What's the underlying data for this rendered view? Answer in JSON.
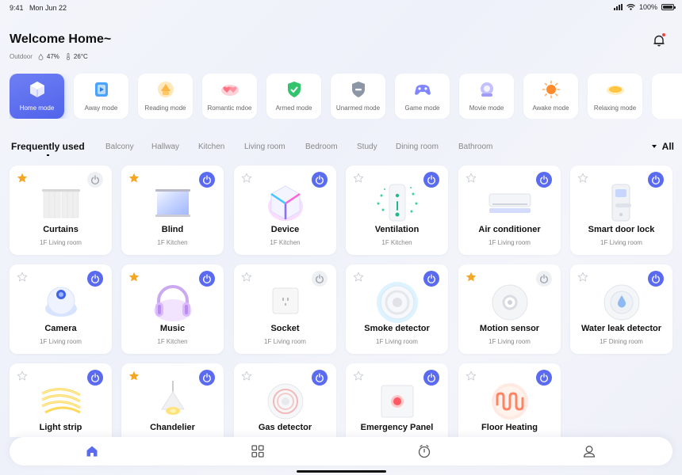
{
  "status": {
    "time": "9:41",
    "date": "Mon Jun 22",
    "battery": "100%"
  },
  "header": {
    "title": "Welcome Home~",
    "outdoor_label": "Outdoor",
    "humidity": "47%",
    "temperature": "26°C"
  },
  "modes": [
    {
      "label": "Home mode",
      "icon": "home-cube-icon",
      "active": true
    },
    {
      "label": "Away mode",
      "icon": "away-icon",
      "active": false
    },
    {
      "label": "Reading mode",
      "icon": "reading-lamp-icon",
      "active": false
    },
    {
      "label": "Romantic mdoe",
      "icon": "romantic-hearts-icon",
      "active": false
    },
    {
      "label": "Armed mode",
      "icon": "shield-check-icon",
      "active": false
    },
    {
      "label": "Unarmed mode",
      "icon": "shield-off-icon",
      "active": false
    },
    {
      "label": "Game mode",
      "icon": "gamepad-icon",
      "active": false
    },
    {
      "label": "Movie mode",
      "icon": "movie-icon",
      "active": false
    },
    {
      "label": "Awake mode",
      "icon": "sun-icon",
      "active": false
    },
    {
      "label": "Relaxing mode",
      "icon": "relax-light-icon",
      "active": false
    }
  ],
  "filters": {
    "title": "Frequently used",
    "tabs": [
      "Balcony",
      "Hallway",
      "Kitchen",
      "Living room",
      "Bedroom",
      "Study",
      "Dining room",
      "Bathroom"
    ],
    "all_label": "All"
  },
  "devices": [
    {
      "name": "Curtains",
      "location": "1F Living room",
      "starred": true,
      "power": "off",
      "icon": "curtains-icon"
    },
    {
      "name": "Blind",
      "location": "1F Kitchen",
      "starred": true,
      "power": "on",
      "icon": "blind-icon"
    },
    {
      "name": "Device",
      "location": "1F Kitchen",
      "starred": false,
      "power": "on",
      "icon": "device-cube-icon"
    },
    {
      "name": "Ventilation",
      "location": "1F Kitchen",
      "starred": false,
      "power": "on",
      "icon": "ventilation-icon"
    },
    {
      "name": "Air conditioner",
      "location": "1F Living room",
      "starred": false,
      "power": "on",
      "icon": "air-conditioner-icon"
    },
    {
      "name": "Smart door lock",
      "location": "1F Living room",
      "starred": false,
      "power": "on",
      "icon": "door-lock-icon"
    },
    {
      "name": "Camera",
      "location": "1F Living room",
      "starred": false,
      "power": "on",
      "icon": "camera-icon"
    },
    {
      "name": "Music",
      "location": "1F Kitchen",
      "starred": true,
      "power": "on",
      "icon": "headphones-icon"
    },
    {
      "name": "Socket",
      "location": "1F Living room",
      "starred": false,
      "power": "off",
      "icon": "socket-icon"
    },
    {
      "name": "Smoke detector",
      "location": "1F Living room",
      "starred": false,
      "power": "on",
      "icon": "smoke-detector-icon"
    },
    {
      "name": "Motion sensor",
      "location": "1F Living room",
      "starred": true,
      "power": "off",
      "icon": "motion-sensor-icon"
    },
    {
      "name": "Water leak detector",
      "location": "1F Dining room",
      "starred": false,
      "power": "on",
      "icon": "water-leak-icon"
    },
    {
      "name": "Light strip",
      "location": "",
      "starred": false,
      "power": "on",
      "icon": "light-strip-icon"
    },
    {
      "name": "Chandelier",
      "location": "",
      "starred": true,
      "power": "on",
      "icon": "chandelier-icon"
    },
    {
      "name": "Gas detector",
      "location": "",
      "starred": false,
      "power": "on",
      "icon": "gas-detector-icon"
    },
    {
      "name": "Emergency Panel",
      "location": "",
      "starred": false,
      "power": "on",
      "icon": "emergency-panel-icon"
    },
    {
      "name": "Floor Heating",
      "location": "",
      "starred": false,
      "power": "on",
      "icon": "floor-heating-icon"
    }
  ],
  "nav": [
    {
      "icon": "home-icon",
      "active": true
    },
    {
      "icon": "grid-icon",
      "active": false
    },
    {
      "icon": "timer-icon",
      "active": false
    },
    {
      "icon": "profile-icon",
      "active": false
    }
  ],
  "colors": {
    "accent": "#5b6bf0",
    "star": "#f5a623",
    "background": "#f1f3fa"
  }
}
